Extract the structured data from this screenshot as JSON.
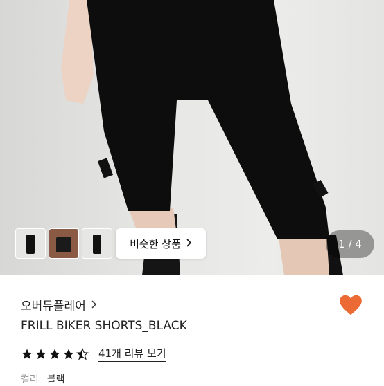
{
  "gallery": {
    "similar_label": "비슷한 상품",
    "counter": "1 / 4",
    "thumbnails": [
      "thumb-1",
      "thumb-2",
      "thumb-3"
    ]
  },
  "product": {
    "brand": "오버듀플레어",
    "name": "FRILL BIKER SHORTS_BLACK",
    "rating": 4.5,
    "reviews_label": "41개 리뷰 보기",
    "color_label": "컬러",
    "color_value": "블랙"
  },
  "colors": {
    "heart": "#ec6a33",
    "star": "#111111"
  }
}
